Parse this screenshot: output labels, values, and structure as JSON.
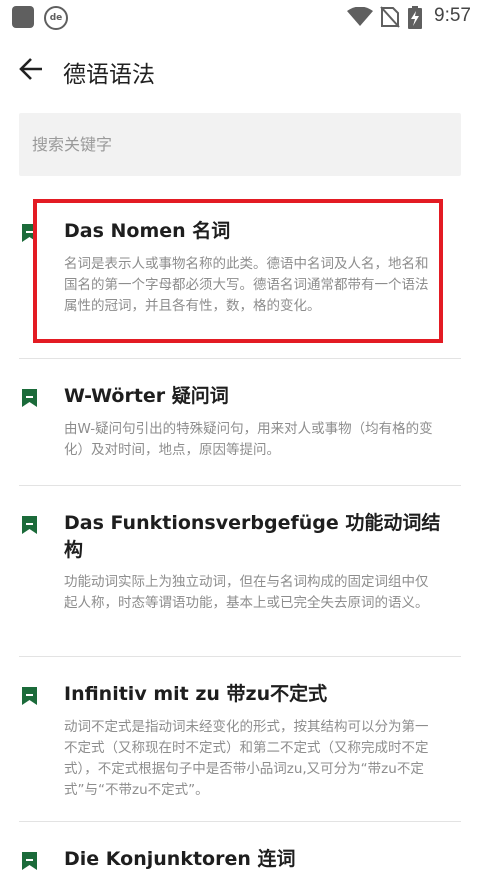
{
  "status_bar": {
    "time": "9:57",
    "app_badge": "de",
    "icons": [
      "app-square-icon",
      "de-badge-icon",
      "wifi-icon",
      "no-sim-icon",
      "battery-charging-icon"
    ]
  },
  "app_bar": {
    "title": "德语语法",
    "back_icon": "arrow-left-icon"
  },
  "search": {
    "placeholder": "搜索关键字",
    "value": ""
  },
  "colors": {
    "accent": "#1b6b3a",
    "highlight": "#e31b23",
    "desc_text": "#8d8d8d"
  },
  "list": {
    "items": [
      {
        "title": "Das Nomen 名词",
        "desc": "名词是表示人或事物名称的此类。德语中名词及人名，地名和国名的第一个字母都必须大写。德语名词通常都带有一个语法属性的冠词，并且各有性，数，格的变化。",
        "icon": "bookmark-icon"
      },
      {
        "title": "W-Wörter 疑问词",
        "desc": "由W-疑问句引出的特殊疑问句，用来对人或事物（均有格的变化）及对时间，地点，原因等提问。",
        "icon": "bookmark-icon"
      },
      {
        "title": "Das Funktionsverbgefüge 功能动词结构",
        "desc": "功能动词实际上为独立动词，但在与名词构成的固定词组中仅起人称，时态等谓语功能，基本上或已完全失去原词的语义。",
        "icon": "bookmark-icon"
      },
      {
        "title": "Infinitiv mit zu  带zu不定式",
        "desc": "动词不定式是指动词未经变化的形式，按其结构可以分为第一不定式（又称现在时不定式）和第二不定式（又称完成时不定式），不定式根据句子中是否带小品词zu,又可分为“带zu不定式”与“不带zu不定式”。",
        "icon": "bookmark-icon"
      },
      {
        "title": "Die Konjunktoren 连词",
        "icon": "bookmark-icon"
      }
    ]
  }
}
